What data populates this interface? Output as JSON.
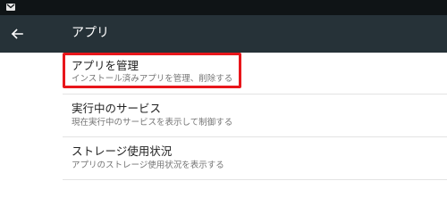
{
  "status_bar": {
    "notification_icon": "gmail-icon"
  },
  "toolbar": {
    "back_icon": "arrow-left-icon",
    "title": "アプリ"
  },
  "items": [
    {
      "title": "アプリを管理",
      "summary": "インストール済みアプリを管理、削除する",
      "highlighted": true
    },
    {
      "title": "実行中のサービス",
      "summary": "現在実行中のサービスを表示して制御する"
    },
    {
      "title": "ストレージ使用状況",
      "summary": "アプリのストレージ使用状況を表示する"
    }
  ],
  "colors": {
    "status_bar": "#0f1416",
    "toolbar": "#263238",
    "highlight_border": "#e8161b"
  }
}
